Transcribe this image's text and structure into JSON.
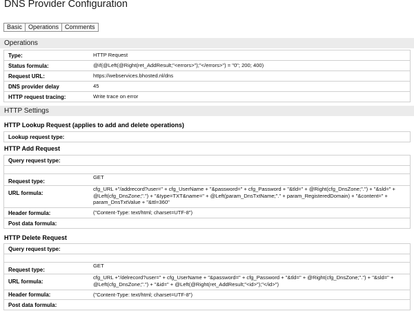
{
  "page": {
    "title": "DNS Provider Configuration"
  },
  "tabs": [
    {
      "label": "Basic"
    },
    {
      "label": "Operations"
    },
    {
      "label": "Comments"
    }
  ],
  "operations": {
    "heading": "Operations",
    "rows": [
      {
        "label": "Type:",
        "value": "HTTP Request"
      },
      {
        "label": "Status formula:",
        "value": "@if(@Left(@Right(ret_AddResult;\"<errors>\");\"</errors>\") = \"0\"; 200; 400)"
      },
      {
        "label": "Request URL:",
        "value": "https://webservices.bhosted.nl/dns"
      },
      {
        "label": "DNS provider delay",
        "value": "45"
      },
      {
        "label": "HTTP request tracing:",
        "value": "Write trace on error"
      }
    ]
  },
  "http_settings": {
    "heading": "HTTP Settings",
    "lookup_request": {
      "heading": "HTTP Lookup Request (applies to add and delete operations)",
      "lookup_request_type": {
        "label": "Lookup request type:"
      }
    },
    "add_request": {
      "heading": "HTTP Add Request",
      "query_request_type": {
        "label": "Query request type:"
      },
      "request_type": {
        "label": "Request type:",
        "value": "GET"
      },
      "url_formula": {
        "label": "URL formula:",
        "value": "cfg_URL +\"/addrecord?user=\" + cfg_UserName + \"&password=\" + cfg_Password + \"&tld=\" + @Right(cfg_DnsZone;\".\") + \"&sld=\" + @Left(cfg_DnsZone;\".\") + \"&type=TXT&name=\" + @Left(param_DnsTxtName;\".\" + param_RegisteredDomain) + \"&content=\" + param_DnsTxtValue + \"&ttl=360\""
      },
      "header_formula": {
        "label": "Header formula:",
        "value": "(\"Content-Type: text/html; charset=UTF-8\")"
      },
      "post_data_formula": {
        "label": "Post data formula:"
      }
    },
    "delete_request": {
      "heading": "HTTP Delete Request",
      "query_request_type": {
        "label": "Query request type:"
      },
      "request_type": {
        "label": "Request type:",
        "value": "GET"
      },
      "url_formula": {
        "label": "URL formula:",
        "value": "cfg_URL +\"/delrecord?user=\" + cfg_UserName + \"&password=\" + cfg_Password + \"&tld=\" + @Right(cfg_DnsZone;\".\") + \"&sld=\" + @Left(cfg_DnsZone;\".\") + \"&id=\" + @Left(@Right(ret_AddResult;\"<id>\");\"</id>\")"
      },
      "header_formula": {
        "label": "Header formula:",
        "value": "(\"Content-Type: text/html; charset=UTF-8\")"
      },
      "post_data_formula": {
        "label": "Post data formula:"
      }
    }
  }
}
